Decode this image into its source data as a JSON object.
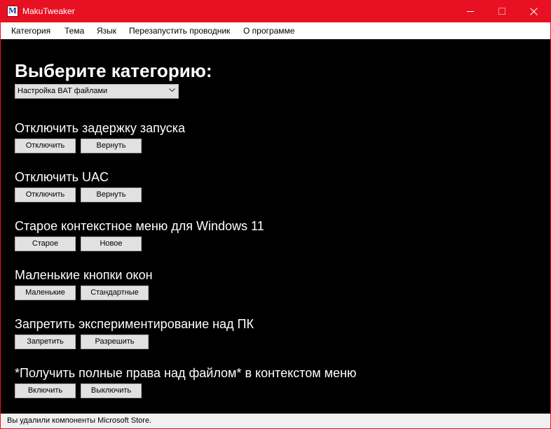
{
  "window": {
    "title": "MakuTweaker",
    "accent_color": "#e81123"
  },
  "menu": {
    "items": [
      {
        "label": "Категория"
      },
      {
        "label": "Тема"
      },
      {
        "label": "Язык"
      },
      {
        "label": "Перезапустить проводник"
      },
      {
        "label": "О программе"
      }
    ]
  },
  "main": {
    "heading": "Выберите категорию:",
    "category_select": {
      "value": "Настройка BAT файлами"
    },
    "sections": [
      {
        "title": "Отключить задержку запуска",
        "buttons": [
          "Отключить",
          "Вернуть"
        ]
      },
      {
        "title": "Отключить UAC",
        "buttons": [
          "Отключить",
          "Вернуть"
        ]
      },
      {
        "title": "Старое контекстное меню для Windows 11",
        "buttons": [
          "Старое",
          "Новое"
        ]
      },
      {
        "title": "Маленькие кнопки окон",
        "buttons": [
          "Маленькие",
          "Стандартные"
        ]
      },
      {
        "title": "Запретить экспериментирование над ПК",
        "buttons": [
          "Запретить",
          "Разрешить"
        ]
      },
      {
        "title": "*Получить полные права над файлом* в контекстом меню",
        "buttons": [
          "Включить",
          "Выключить"
        ]
      }
    ]
  },
  "status": {
    "text": "Вы удалили компоненты Microsoft Store."
  },
  "icons": {
    "app": "app-logo-icon",
    "minimize": "minimize-icon",
    "maximize": "maximize-icon",
    "close": "close-icon",
    "dropdown": "chevron-down-icon"
  }
}
